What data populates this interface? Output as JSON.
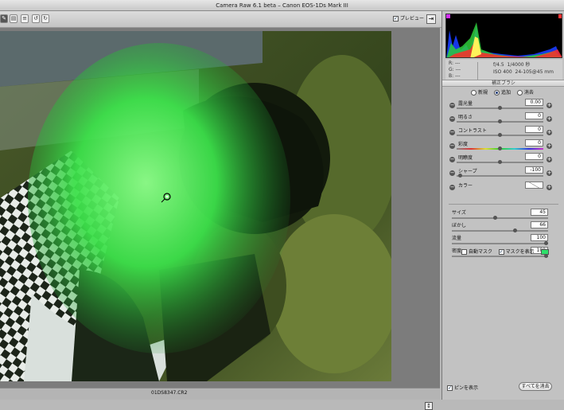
{
  "window": {
    "title": "Camera Raw 6.1 beta  –  Canon EOS-1Ds Mark III"
  },
  "toolbar": {
    "tools": [
      "zoom-tool",
      "adjust-brush-tool",
      "preferences-tool",
      "rotate-left-tool",
      "rotate-right-tool"
    ],
    "preview_label": "プレビュー",
    "preview_checked": true
  },
  "image": {
    "filename": "01DS8347.CR2"
  },
  "histogram": {
    "rgb_labels": [
      "R:",
      "G:",
      "B:"
    ],
    "rgb_values": [
      "---",
      "---",
      "---"
    ]
  },
  "camera_info": {
    "aperture": "f/4.5",
    "shutter": "1/4000 秒",
    "iso": "ISO 400",
    "lens": "24-105@45 mm"
  },
  "panel": {
    "section_title": "補正ブラシ",
    "modes": [
      {
        "label": "新規",
        "selected": false
      },
      {
        "label": "追加",
        "selected": true
      },
      {
        "label": "消去",
        "selected": false
      }
    ],
    "sliders": [
      {
        "label": "露光量",
        "value": "0.00",
        "pos": 0.5
      },
      {
        "label": "明るさ",
        "value": "0",
        "pos": 0.5
      },
      {
        "label": "コントラスト",
        "value": "0",
        "pos": 0.5
      },
      {
        "label": "彩度",
        "value": "0",
        "pos": 0.5
      },
      {
        "label": "明瞭度",
        "value": "0",
        "pos": 0.5
      },
      {
        "label": "シャープ",
        "value": "-100",
        "pos": 0.02
      }
    ],
    "color_label": "カラー",
    "brush": [
      {
        "label": "サイズ",
        "value": "45",
        "pos": 0.45
      },
      {
        "label": "ぼかし",
        "value": "66",
        "pos": 0.66
      },
      {
        "label": "流量",
        "value": "100",
        "pos": 1.0
      },
      {
        "label": "密度",
        "value": "100",
        "pos": 1.0
      }
    ],
    "auto_mask_label": "自動マスク",
    "auto_mask_checked": false,
    "show_mask_label": "マスクを表示",
    "show_mask_checked": true,
    "mask_color": "#2ee06a",
    "show_pins_label": "ピンを表示",
    "show_pins_checked": true,
    "clear_all_label": "すべてを消去"
  }
}
